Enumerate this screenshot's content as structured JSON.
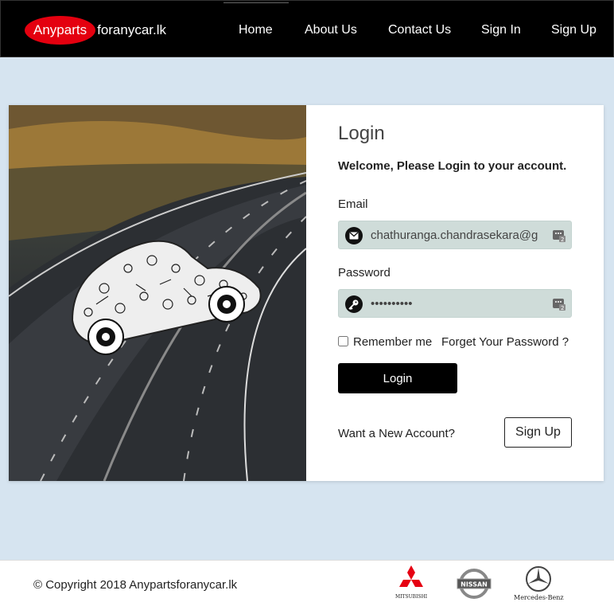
{
  "navbar": {
    "brand_highlight": "Anyparts",
    "brand_rest": "foranycar.lk",
    "links": [
      "Home",
      "About Us",
      "Contact Us",
      "Sign In",
      "Sign Up"
    ],
    "brand_color": "#e4000f"
  },
  "login": {
    "title": "Login",
    "subtitle": "Welcome, Please Login to your account.",
    "email_label": "Email",
    "email_value": "chathuranga.chandrasekara@gmail.com",
    "password_label": "Password",
    "password_value": "••••••••••",
    "remember_label": "Remember me",
    "forgot_label": "Forget Your Password ?",
    "login_button": "Login",
    "new_account_text": "Want a New Account?",
    "signup_button": "Sign Up"
  },
  "footer": {
    "copyright": "© Copyright 2018 Anypartsforanycar.lk",
    "brands": [
      "MITSUBISHI",
      "NISSAN",
      "Mercedes-Benz"
    ]
  },
  "icons": {
    "email": "envelope-icon",
    "password": "key-icon",
    "autofill": "password-manager-icon"
  }
}
